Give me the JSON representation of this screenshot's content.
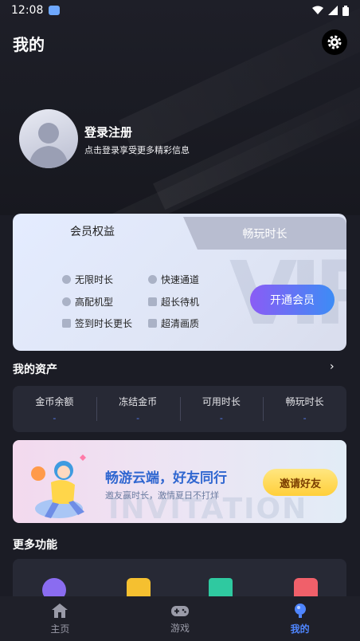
{
  "status_bar": {
    "time": "12:08"
  },
  "header": {
    "title": "我的"
  },
  "profile": {
    "login_title": "登录注册",
    "login_subtitle": "点击登录享受更多精彩信息"
  },
  "member_card": {
    "tabs": [
      {
        "label": "会员权益",
        "active": true
      },
      {
        "label": "畅玩时长",
        "active": false
      }
    ],
    "benefits": [
      {
        "label": "无限时长",
        "icon": "clock-icon"
      },
      {
        "label": "快速通道",
        "icon": "plus-circle-icon"
      },
      {
        "label": "高配机型",
        "icon": "gear-icon"
      },
      {
        "label": "超长待机",
        "icon": "gamepad-icon"
      },
      {
        "label": "签到时长更长",
        "icon": "calendar-icon"
      },
      {
        "label": "超清画质",
        "icon": "hd-icon"
      }
    ],
    "open_button": "开通会员",
    "accent_from": "#8a5cf5",
    "accent_to": "#3d8cf5"
  },
  "assets": {
    "title": "我的资产",
    "items": [
      {
        "label": "金币余额",
        "value": "-"
      },
      {
        "label": "冻结金币",
        "value": "-"
      },
      {
        "label": "可用时长",
        "value": "-"
      },
      {
        "label": "畅玩时长",
        "value": "-"
      }
    ]
  },
  "banner": {
    "title": "畅游云端，好友同行",
    "subtitle": "邀友赢时长，激情夏日不打烊",
    "button": "邀请好友",
    "background_text": "INVITATION"
  },
  "more": {
    "title": "更多功能",
    "icons": [
      "coin-icon",
      "gift-icon",
      "scan-icon",
      "calendar-icon"
    ]
  },
  "tabbar": {
    "items": [
      {
        "label": "主页",
        "icon": "home-icon",
        "active": false
      },
      {
        "label": "游戏",
        "icon": "gamepad-icon",
        "active": false
      },
      {
        "label": "我的",
        "icon": "user-icon",
        "active": true
      }
    ],
    "active_color": "#4f86ff"
  }
}
